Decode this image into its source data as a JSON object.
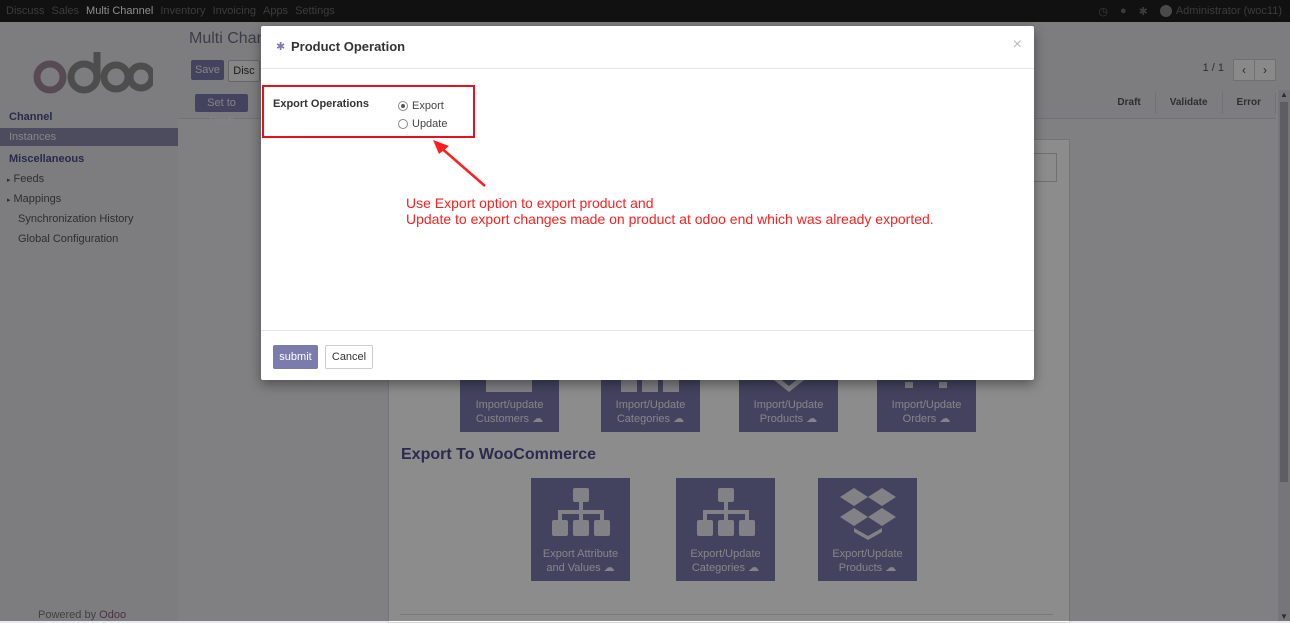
{
  "topbar": {
    "menu": [
      "Discuss",
      "Sales",
      "Multi Channel",
      "Inventory",
      "Invoicing",
      "Apps",
      "Settings"
    ],
    "active": "Multi Channel",
    "user": "Administrator (woc11)"
  },
  "sidebar": {
    "section1": "Channel",
    "instances": "Instances",
    "section2": "Miscellaneous",
    "feeds": "Feeds",
    "mappings": "Mappings",
    "sync_history": "Synchronization History",
    "global_config": "Global Configuration",
    "powered_prefix": "Powered by",
    "powered_brand": "Odoo"
  },
  "control": {
    "breadcrumb": "Multi Chann",
    "save": "Save",
    "discard": "Disc",
    "pager": "1 / 1"
  },
  "statusbar": {
    "set_to_draft": "Set to Draft",
    "stages": [
      "Draft",
      "Validate",
      "Error"
    ]
  },
  "sheet": {
    "import_tiles": [
      {
        "line1": "Import/update",
        "line2": "Customers"
      },
      {
        "line1": "Import/Update",
        "line2": "Categories"
      },
      {
        "line1": "Import/Update",
        "line2": "Products"
      },
      {
        "line1": "Import/Update",
        "line2": "Orders"
      }
    ],
    "export_title": "Export To WooCommerce",
    "export_tiles": [
      {
        "line1": "Export Attribute",
        "line2": "and Values"
      },
      {
        "line1": "Export/Update",
        "line2": "Categories"
      },
      {
        "line1": "Export/Update",
        "line2": "Products"
      }
    ]
  },
  "modal": {
    "title": "Product Operation",
    "field_label": "Export Operations",
    "options": [
      "Export",
      "Update"
    ],
    "selected": "Export",
    "annotation_line1": "Use Export option to export product and",
    "annotation_line2": "Update to export changes made on product at odoo end which was already exported.",
    "submit": "submit",
    "cancel": "Cancel"
  },
  "colors": {
    "accent": "#7c7bad",
    "annotation": "#ff1f1f"
  }
}
